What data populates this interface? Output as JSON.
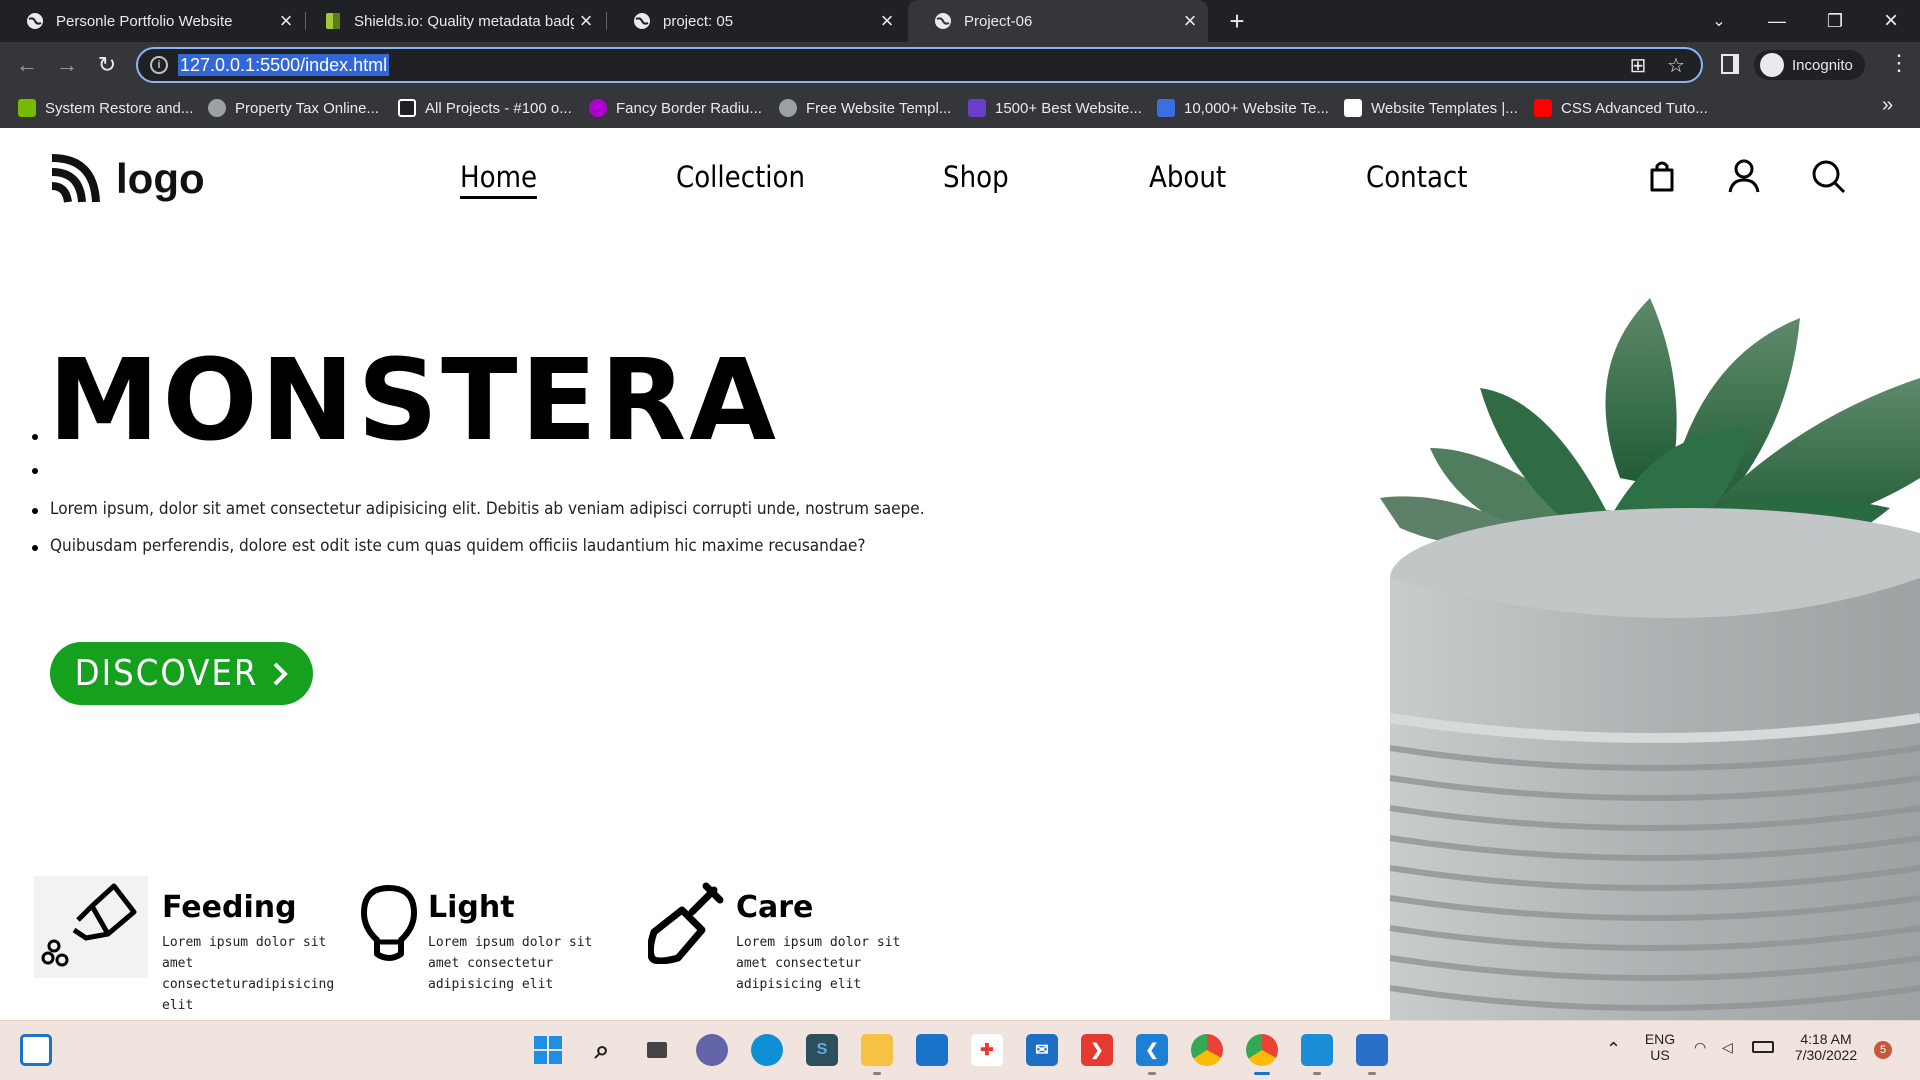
{
  "browser": {
    "tabs": [
      {
        "title": "Personle Portfolio Website",
        "active": false
      },
      {
        "title": "Shields.io: Quality metadata badg",
        "active": false
      },
      {
        "title": "project: 05",
        "active": false
      },
      {
        "title": "Project-06",
        "active": true
      }
    ],
    "new_tab_label": "+",
    "address": "127.0.0.1:5500/index.html",
    "profile_label": "Incognito",
    "bookmarks": [
      {
        "label": "System Restore and...",
        "icon": "nvidia-icon",
        "color": "#76b900"
      },
      {
        "label": "Property Tax Online...",
        "icon": "globe-icon",
        "color": "#9aa0a6"
      },
      {
        "label": "All Projects - #100 o...",
        "icon": "codepen-icon",
        "color": "#ffffff"
      },
      {
        "label": "Fancy Border Radiu...",
        "icon": "purple-blob-icon",
        "color": "#b000d0"
      },
      {
        "label": "Free Website Templ...",
        "icon": "globe-icon",
        "color": "#9aa0a6"
      },
      {
        "label": "1500+ Best Website...",
        "icon": "colorlib-icon",
        "color": "#6a3fc8"
      },
      {
        "label": "10,000+ Website Te...",
        "icon": "n-icon",
        "color": "#3b6fe0"
      },
      {
        "label": "Website Templates |...",
        "icon": "wix-icon",
        "color": "#ffffff"
      },
      {
        "label": "CSS Advanced Tuto...",
        "icon": "youtube-icon",
        "color": "#ff0000"
      }
    ]
  },
  "site": {
    "logo_text": "logo",
    "nav": [
      {
        "label": "Home",
        "active": true
      },
      {
        "label": "Collection",
        "active": false
      },
      {
        "label": "Shop",
        "active": false
      },
      {
        "label": "About",
        "active": false
      },
      {
        "label": "Contact",
        "active": false
      }
    ],
    "nav_icons": [
      "shopping-bag-icon",
      "user-icon",
      "search-icon"
    ],
    "hero": {
      "title": "MONSTERA",
      "line1": "Lorem ipsum, dolor sit amet consectetur adipisicing elit. Debitis ab veniam adipisci corrupti unde, nostrum saepe.",
      "line2": "Quibusdam perferendis, dolore est odit iste cum quas quidem officiis laudantium hic maxime recusandae?",
      "cta_label": "DISCOVER",
      "cta_color": "#15a01e"
    },
    "features": [
      {
        "title": "Feeding",
        "text": "Lorem ipsum dolor sit amet consecteturadipisicing elit",
        "icon": "watering-can-icon"
      },
      {
        "title": "Light",
        "text": "Lorem ipsum dolor sit amet consectetur adipisicing elit",
        "icon": "light-bulb-icon"
      },
      {
        "title": "Care",
        "text": "Lorem ipsum dolor sit amet consectetur adipisicing elit",
        "icon": "shovel-icon"
      }
    ]
  },
  "taskbar": {
    "apps": [
      "search-icon",
      "task-view-icon",
      "teams-chat-icon",
      "edge-icon",
      "sublime-icon",
      "file-explorer-icon",
      "store-icon",
      "gift-icon",
      "mail-icon",
      "git-icon",
      "vscode-icon",
      "chrome-icon",
      "chrome-profile-icon",
      "notepad-icon",
      "photos-icon"
    ],
    "lang_line1": "ENG",
    "lang_line2": "US",
    "time": "4:18 AM",
    "date": "7/30/2022",
    "notifications": "5"
  }
}
